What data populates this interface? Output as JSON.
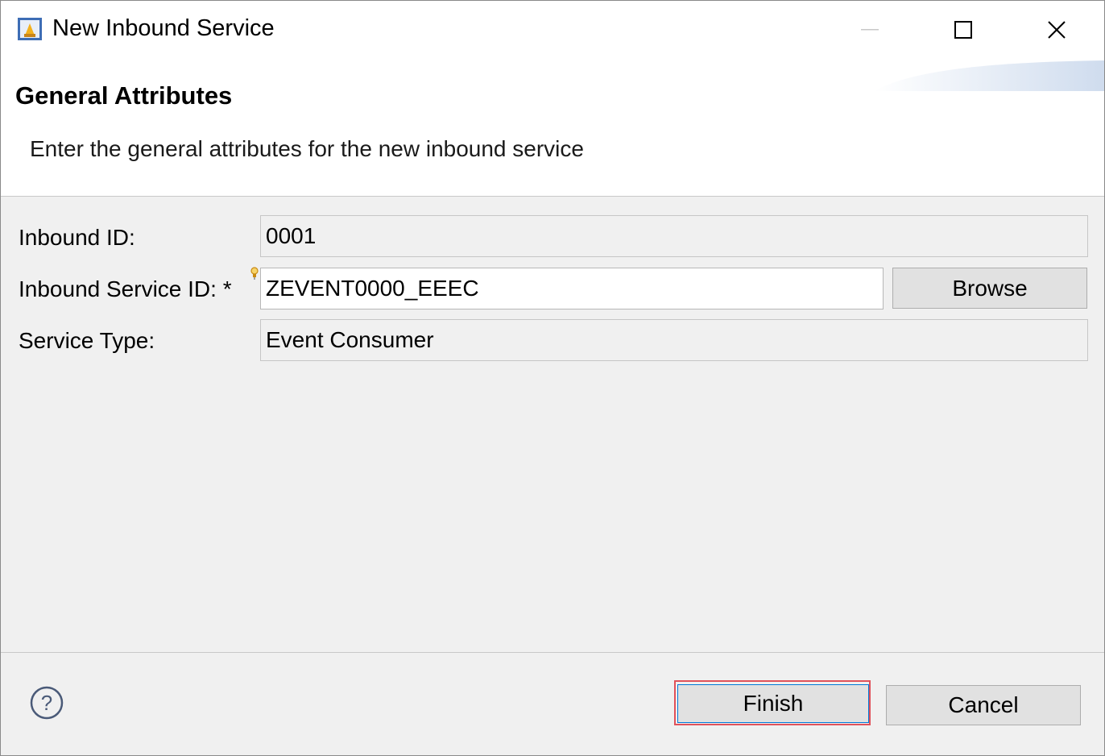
{
  "window": {
    "title": "New Inbound Service",
    "app_icon": "adt-wizard-icon",
    "controls": {
      "minimize": "minimize-icon",
      "maximize": "maximize-icon",
      "close": "close-icon"
    }
  },
  "header": {
    "title": "General Attributes",
    "description": "Enter the general attributes for the new inbound service"
  },
  "form": {
    "inbound_id": {
      "label": "Inbound ID:",
      "value": "0001"
    },
    "inbound_service_id": {
      "label": "Inbound Service ID: *",
      "value": "ZEVENT0000_EEEC",
      "decoration_icon": "content-assist-lightbulb-icon"
    },
    "browse_label": "Browse",
    "service_type": {
      "label": "Service Type:",
      "value": "Event Consumer"
    }
  },
  "footer": {
    "help_icon": "help-icon",
    "finish_label": "Finish",
    "cancel_label": "Cancel"
  },
  "colors": {
    "highlight_outline": "#e0525a",
    "field_border": "#c6c6c6",
    "button_face": "#e1e1e1"
  }
}
